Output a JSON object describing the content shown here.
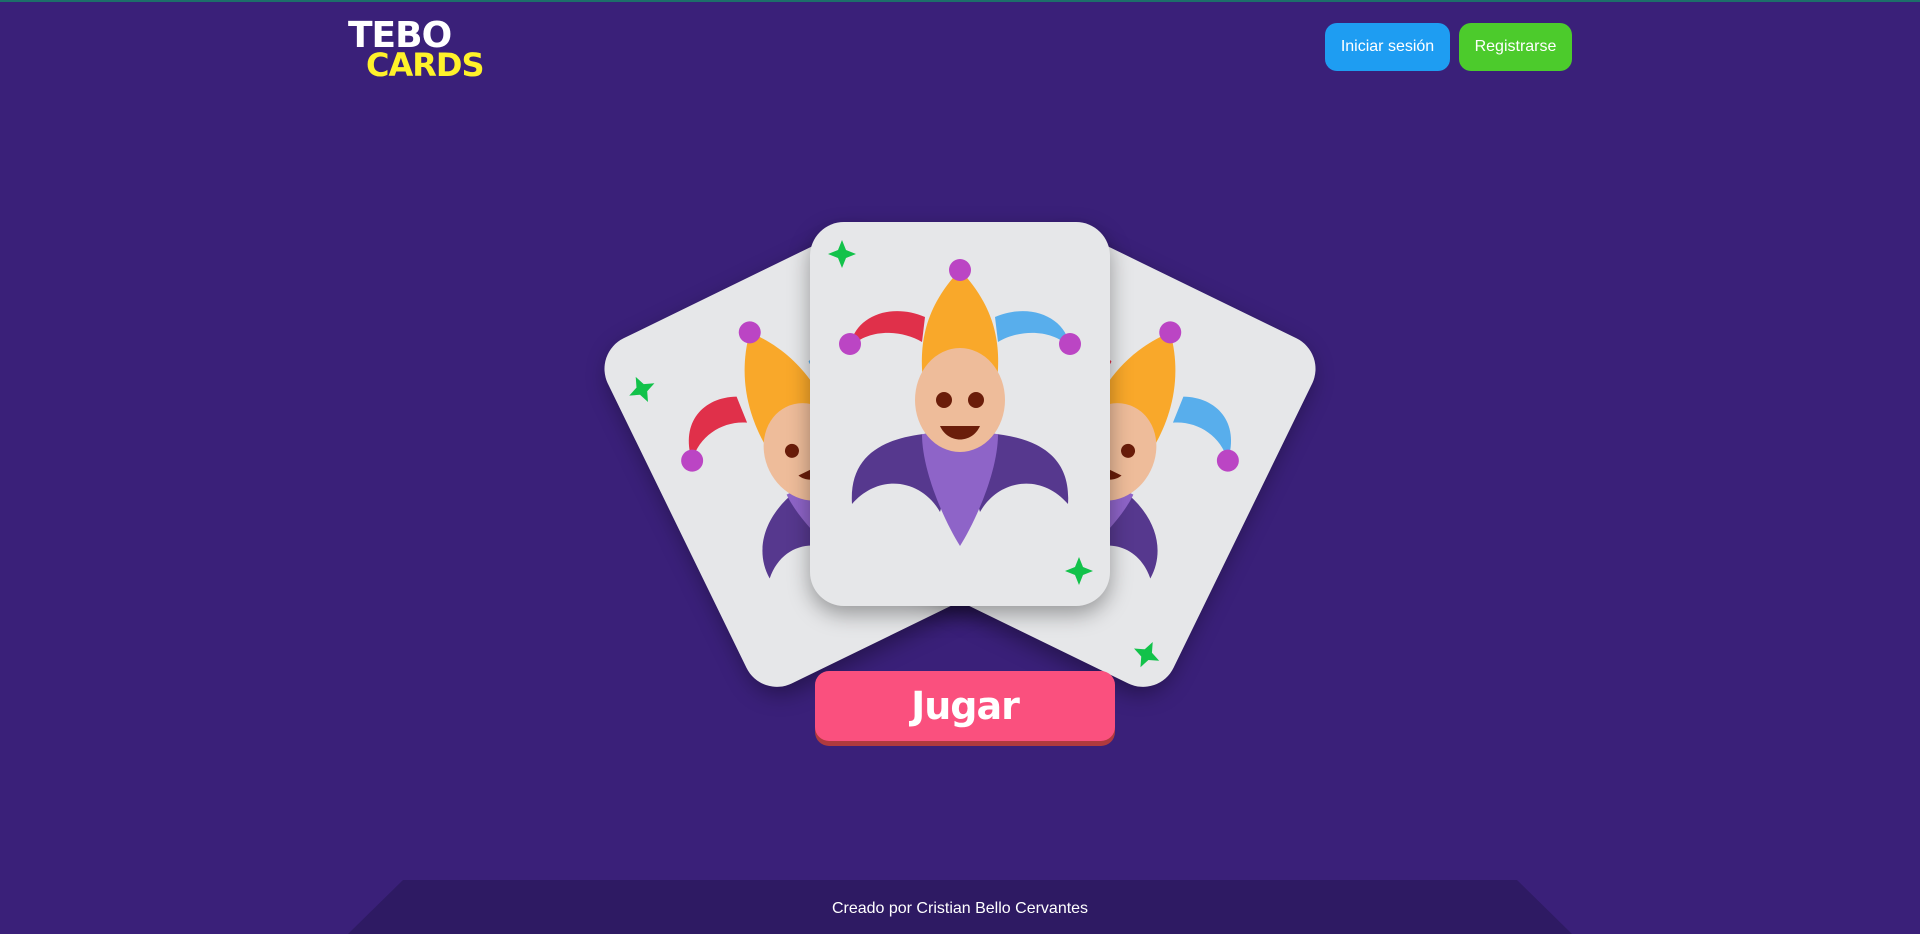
{
  "header": {
    "logo": {
      "line1": "TEBO",
      "line2": "CARDS"
    },
    "login_label": "Iniciar sesión",
    "register_label": "Registrarse"
  },
  "main": {
    "cards": [
      {
        "name": "card-joker-left",
        "icon": "joker-icon",
        "sparkle": "sparkle-icon"
      },
      {
        "name": "card-joker-center",
        "icon": "joker-icon",
        "sparkle": "sparkle-icon"
      },
      {
        "name": "card-joker-right",
        "icon": "joker-icon",
        "sparkle": "sparkle-icon"
      }
    ],
    "play_label": "Jugar"
  },
  "footer": {
    "credit": "Creado por Cristian Bello Cervantes"
  },
  "colors": {
    "background": "#3a2079",
    "footer_bg": "#2e1a63",
    "login_button": "#1e9df2",
    "register_button": "#4ccb2c",
    "play_button": "#fa507e",
    "play_button_shadow": "#b03a3e",
    "card_face": "#e6e7e9",
    "logo_primary": "#ffffff",
    "logo_secondary": "#fff22a",
    "sparkle": "#12c24a"
  }
}
